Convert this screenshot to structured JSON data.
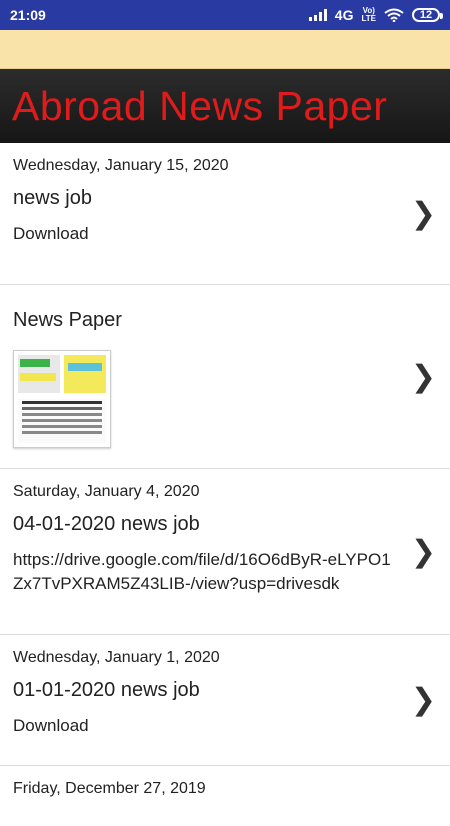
{
  "status_bar": {
    "time": "21:09",
    "network": "4G",
    "volte_top": "Vo)",
    "volte_bottom": "LTE",
    "wifi_icon": "wifi-icon",
    "battery": "12"
  },
  "header": {
    "title": "Abroad News Paper"
  },
  "items": [
    {
      "date": "Wednesday, January 15, 2020",
      "title": "news job",
      "body": "Download"
    },
    {
      "title": "News Paper"
    },
    {
      "date": "Saturday, January 4, 2020",
      "title": "04-01-2020 news job",
      "body": "https://drive.google.com/file/d/16O6dByR-eLYPO1Zx7TvPXRAM5Z43LIB-/view?usp=drivesdk"
    },
    {
      "date": "Wednesday, January 1, 2020",
      "title": "01-01-2020 news job",
      "body": "Download"
    },
    {
      "date": "Friday, December 27, 2019"
    }
  ],
  "colors": {
    "status_bar": "#2a3aa3",
    "title_red": "#e01b1b",
    "ad_banner": "#f9e3a8"
  }
}
